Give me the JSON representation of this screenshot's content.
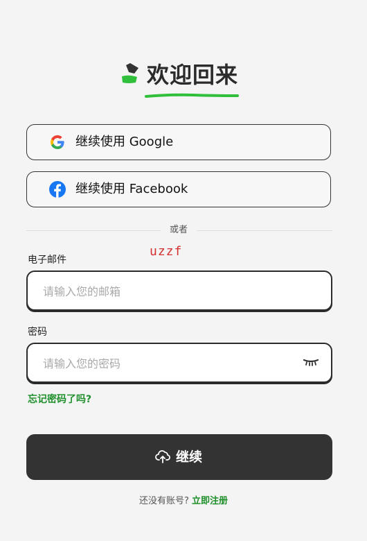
{
  "header": {
    "title": "欢迎回来"
  },
  "social": {
    "google_label": "继续使用 Google",
    "facebook_label": "继续使用 Facebook"
  },
  "divider_text": "或者",
  "watermark": "uzzf",
  "email": {
    "label": "电子邮件",
    "placeholder": "请输入您的邮箱",
    "value": ""
  },
  "password": {
    "label": "密码",
    "placeholder": "请输入您的密码",
    "value": ""
  },
  "forgot_link": "忘记密码了吗?",
  "continue_label": "继续",
  "signup": {
    "prompt": "还没有账号?",
    "link": "立即注册"
  },
  "colors": {
    "accent": "#1e8f2a",
    "button_bg": "#333333",
    "underline": "#2fbf3a"
  },
  "icons": [
    "logo-icon",
    "google-icon",
    "facebook-icon",
    "eye-closed-icon",
    "cloud-upload-icon"
  ]
}
